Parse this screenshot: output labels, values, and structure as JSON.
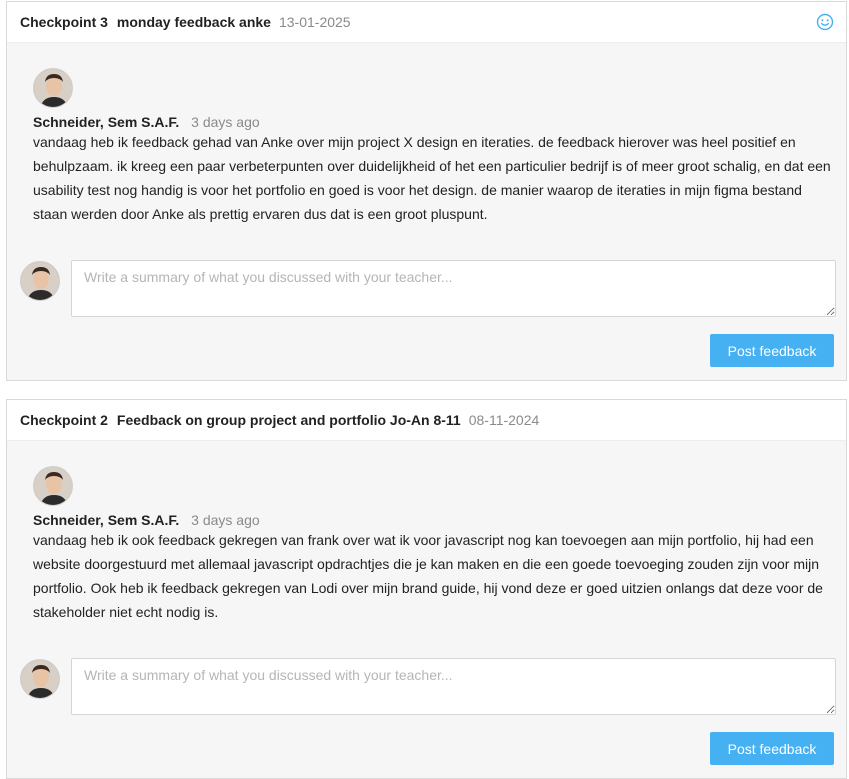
{
  "placeholder": "Write a summary of what you discussed with your teacher...",
  "post_label": "Post feedback",
  "checkpoints": [
    {
      "label": "Checkpoint 3",
      "title": "monday feedback anke",
      "date": "13-01-2025",
      "icon": "smiley-icon",
      "comment": {
        "author": "Schneider, Sem S.A.F.",
        "time": "3 days ago",
        "text": "vandaag heb ik feedback gehad van Anke over mijn project X design en iteraties. de feedback hierover was heel positief en behulpzaam. ik kreeg een paar verbeterpunten over duidelijkheid of het een particulier bedrijf is of meer groot schalig, en dat een usability test nog handig is voor het portfolio en goed is voor het design. de manier waarop de iteraties in mijn figma bestand staan werden door Anke als prettig ervaren dus dat is een groot pluspunt."
      }
    },
    {
      "label": "Checkpoint 2",
      "title": "Feedback on group project and portfolio Jo-An 8-11",
      "date": "08-11-2024",
      "comment": {
        "author": "Schneider, Sem S.A.F.",
        "time": "3 days ago",
        "text": "vandaag heb ik ook feedback gekregen van frank over wat ik voor javascript nog kan toevoegen aan mijn portfolio, hij had een website doorgestuurd met allemaal javascript opdrachtjes die je kan maken en die een goede toevoeging zouden zijn voor mijn portfolio. Ook heb ik feedback gekregen van Lodi over mijn brand guide, hij vond deze er goed uitzien onlangs dat deze voor de stakeholder niet echt nodig is."
      }
    }
  ],
  "colors": {
    "accent": "#45b1f3",
    "card_bg": "#f6f6f6",
    "muted": "#8a8a8a"
  }
}
